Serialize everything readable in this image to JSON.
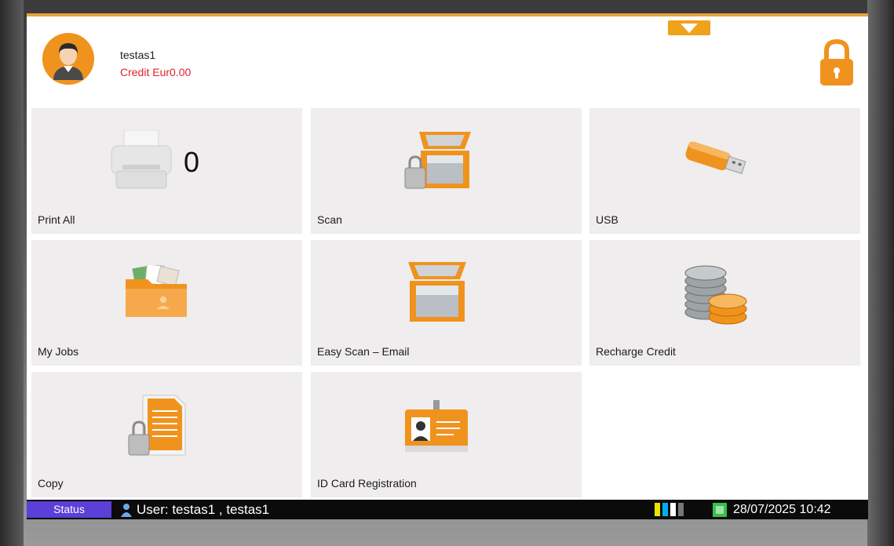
{
  "header": {
    "user_name": "testas1",
    "credit": "Credit Eur0.00",
    "lock_icon": "padlock-icon",
    "avatar_icon": "user-avatar-icon",
    "accent_color": "#f0931e"
  },
  "tiles": [
    {
      "label": "Print All",
      "icon": "printer-icon",
      "count": "0"
    },
    {
      "label": "Scan",
      "icon": "scanner-lock-icon"
    },
    {
      "label": "USB",
      "icon": "usb-drive-icon"
    },
    {
      "label": "My Jobs",
      "icon": "folder-jobs-icon"
    },
    {
      "label": "Easy Scan – Email",
      "icon": "scanner-icon"
    },
    {
      "label": "Recharge Credit",
      "icon": "coins-icon"
    },
    {
      "label": "Copy",
      "icon": "document-lock-icon"
    },
    {
      "label": "ID Card Registration",
      "icon": "id-card-icon"
    }
  ],
  "statusbar": {
    "status_label": "Status",
    "user_info": "User: testas1 , testas1",
    "datetime": "28/07/2025 10:42",
    "status_color": "#5b3fd6"
  }
}
